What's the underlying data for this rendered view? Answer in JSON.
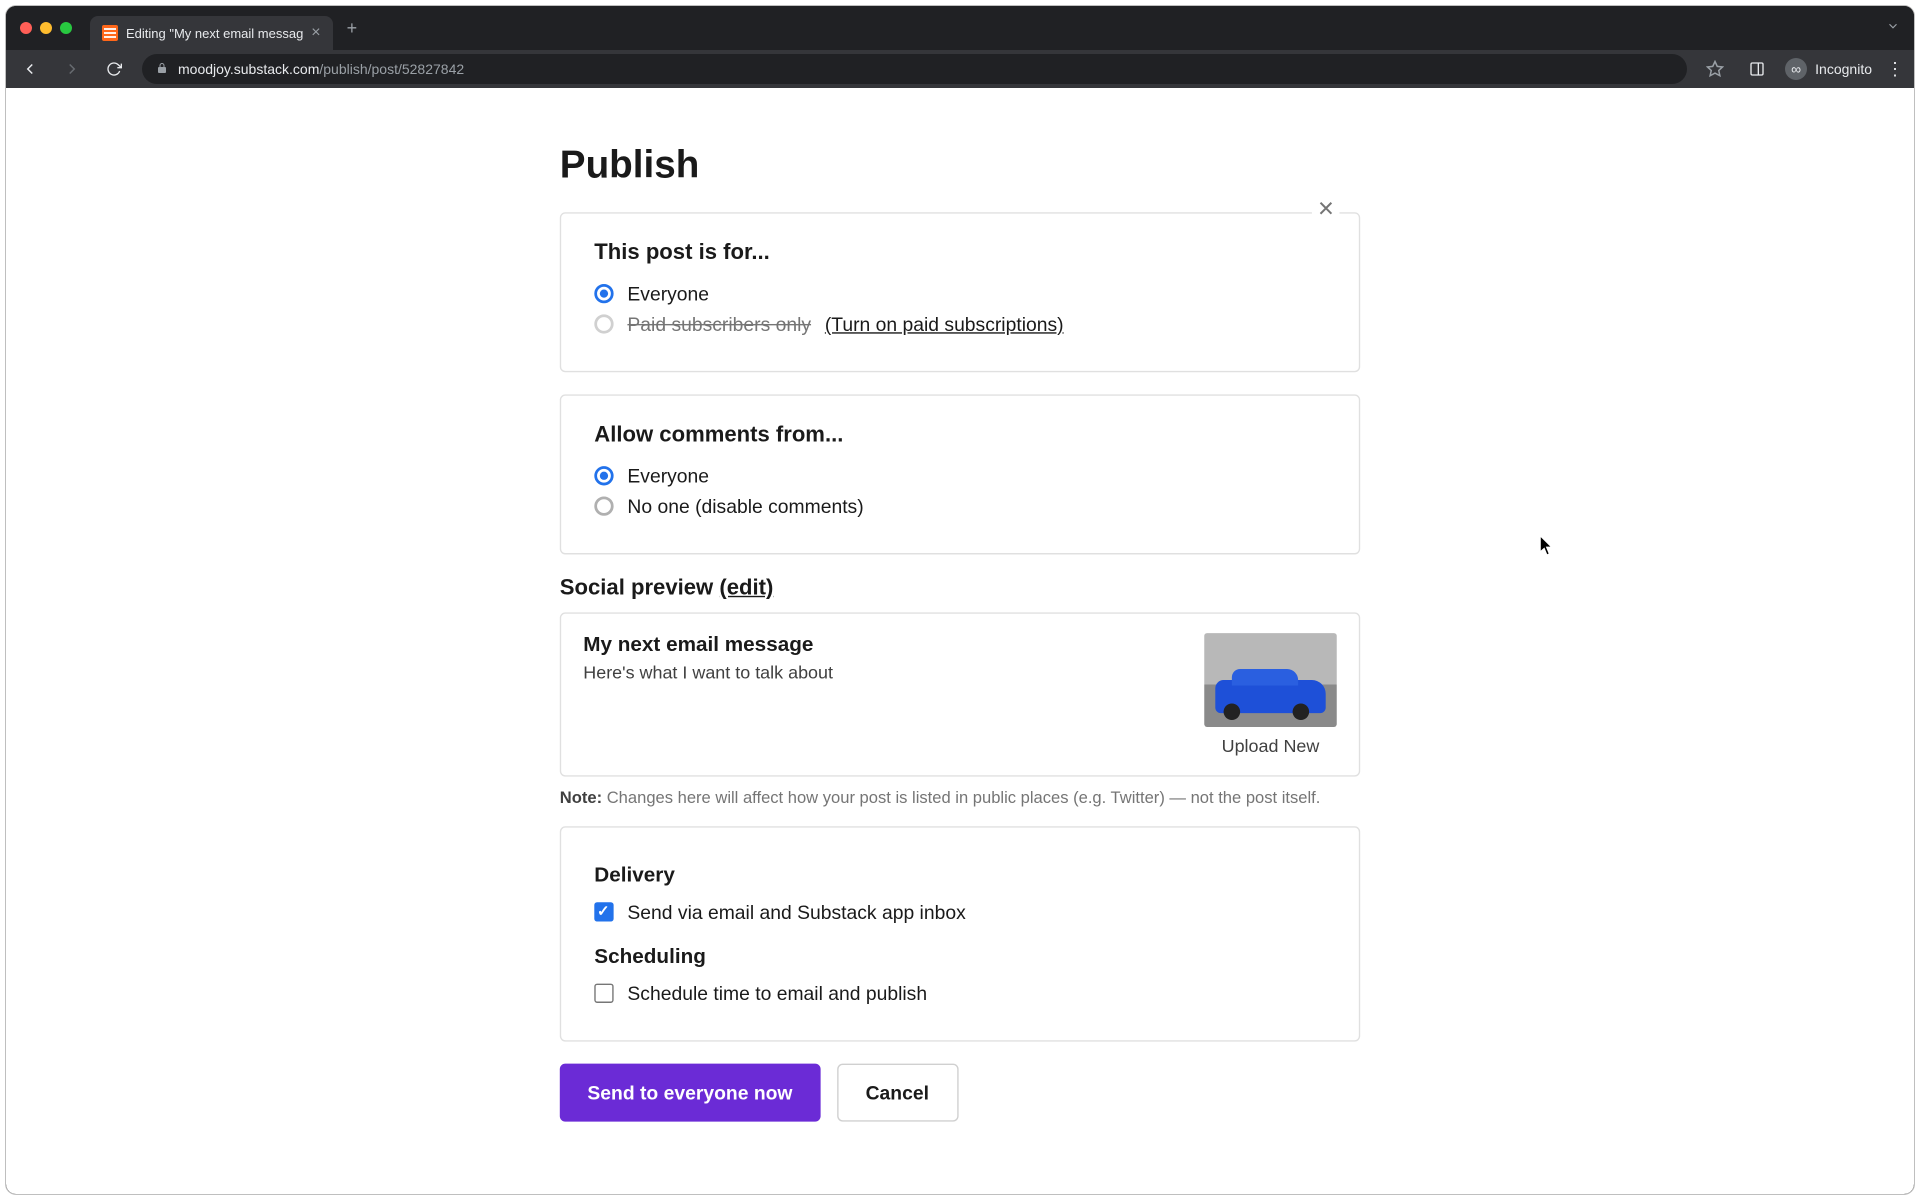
{
  "browser": {
    "tab_title": "Editing \"My next email messag",
    "url_host": "moodjoy.substack.com",
    "url_path": "/publish/post/52827842",
    "incognito_label": "Incognito"
  },
  "page": {
    "title": "Publish",
    "audience": {
      "heading": "This post is for...",
      "opt_everyone": "Everyone",
      "opt_paid_strike": "Paid subscribers only",
      "opt_paid_link": "(Turn on paid subscriptions)"
    },
    "comments": {
      "heading": "Allow comments from...",
      "opt_everyone": "Everyone",
      "opt_none": "No one (disable comments)"
    },
    "social": {
      "heading_prefix": "Social preview ",
      "heading_edit": "(edit)",
      "title": "My next email message",
      "description": "Here's what I want to talk about",
      "upload_label": "Upload New",
      "note_label": "Note:",
      "note_text": " Changes here will affect how your post is listed in public places (e.g. Twitter) — not the post itself."
    },
    "delivery": {
      "heading": "Delivery",
      "send_email": "Send via email and Substack app inbox"
    },
    "scheduling": {
      "heading": "Scheduling",
      "schedule_label": "Schedule time to email and publish"
    },
    "buttons": {
      "primary": "Send to everyone now",
      "cancel": "Cancel"
    }
  }
}
